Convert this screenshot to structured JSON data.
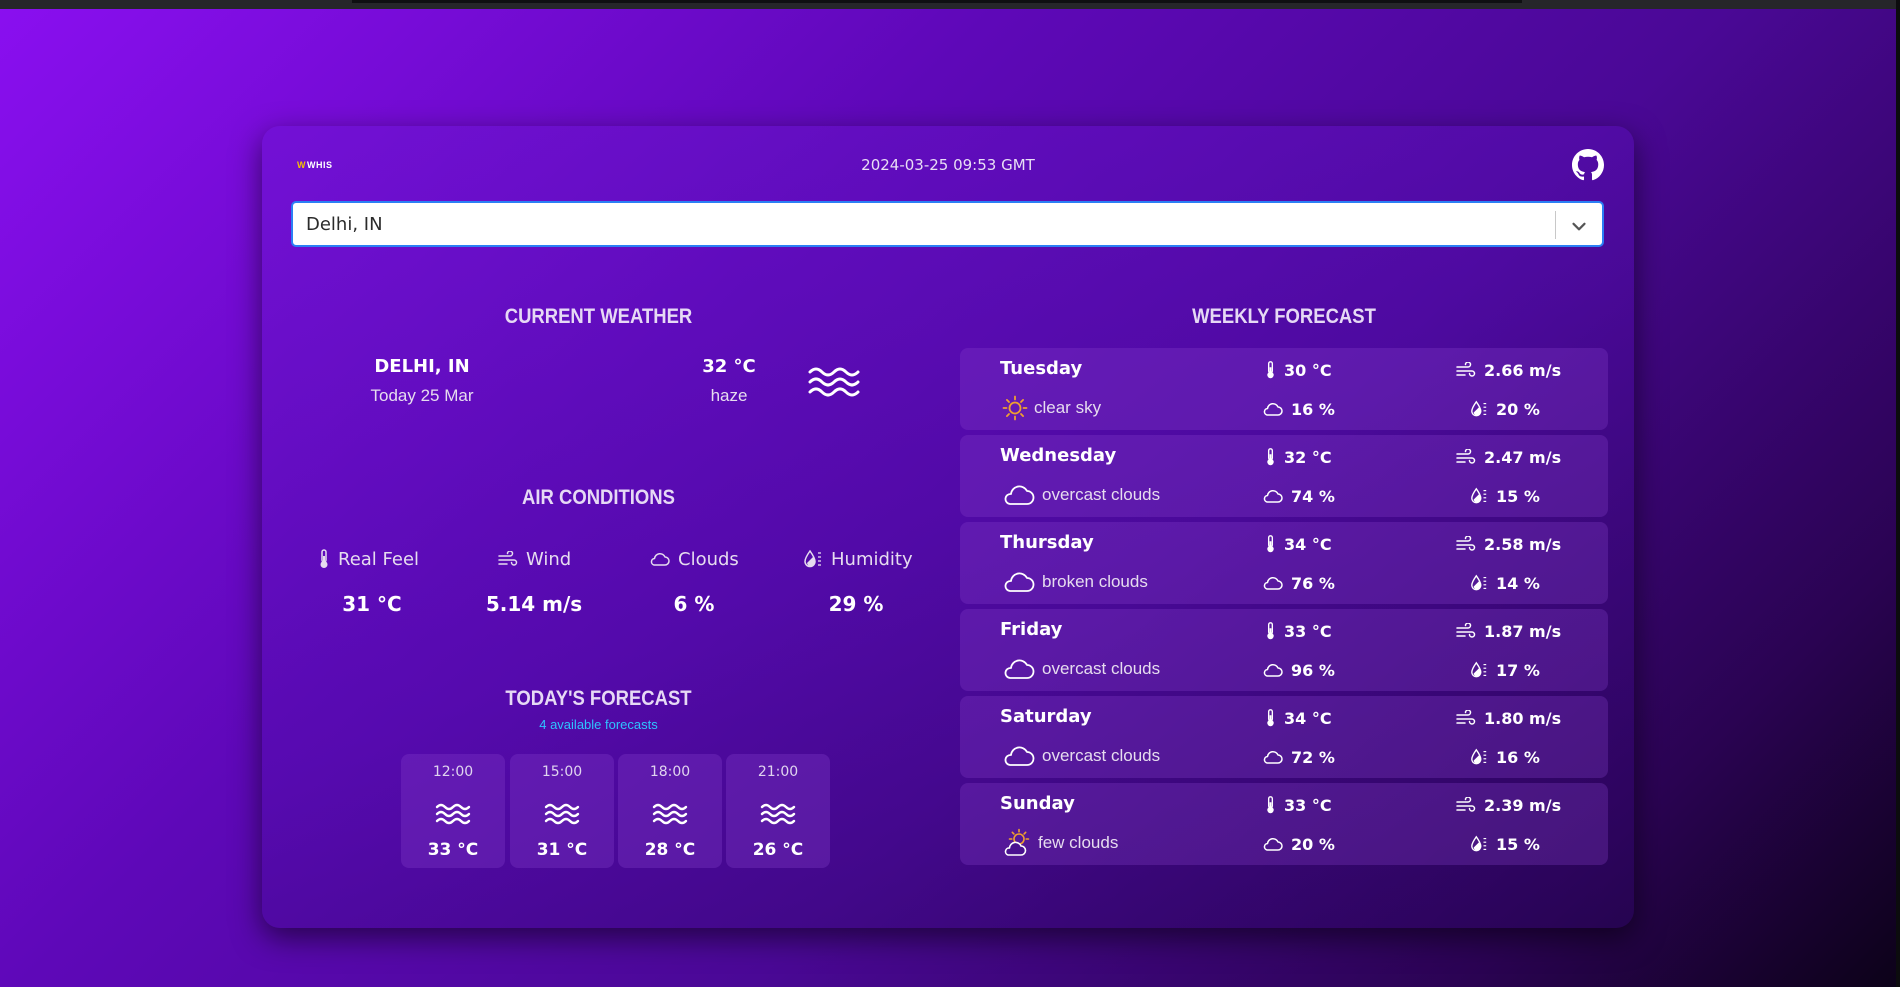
{
  "header": {
    "logo_mark": "W",
    "logo_text": "WHIS",
    "datetime": "2024-03-25 09:53 GMT",
    "github_icon": "github-icon"
  },
  "search": {
    "value": "Delhi, IN",
    "dropdown_icon": "chevron-down-icon"
  },
  "current_weather": {
    "title": "CURRENT WEATHER",
    "city": "DELHI, IN",
    "date": "Today 25 Mar",
    "temperature": "32 °C",
    "description": "haze",
    "icon": "haze-icon"
  },
  "air_conditions": {
    "title": "AIR CONDITIONS",
    "items": [
      {
        "label": "Real Feel",
        "value": "31 °C",
        "icon": "thermometer-icon"
      },
      {
        "label": "Wind",
        "value": "5.14 m/s",
        "icon": "wind-icon"
      },
      {
        "label": "Clouds",
        "value": "6 %",
        "icon": "cloud-icon"
      },
      {
        "label": "Humidity",
        "value": "29 %",
        "icon": "humidity-icon"
      }
    ]
  },
  "todays_forecast": {
    "title": "TODAY'S FORECAST",
    "subtitle": "4 available forecasts",
    "items": [
      {
        "time": "12:00",
        "temperature": "33 °C",
        "icon": "haze-icon"
      },
      {
        "time": "15:00",
        "temperature": "31 °C",
        "icon": "haze-icon"
      },
      {
        "time": "18:00",
        "temperature": "28 °C",
        "icon": "haze-icon"
      },
      {
        "time": "21:00",
        "temperature": "26 °C",
        "icon": "haze-icon"
      }
    ]
  },
  "weekly_forecast": {
    "title": "WEEKLY FORECAST",
    "days": [
      {
        "day": "Tuesday",
        "description": "clear sky",
        "icon": "sun-icon",
        "temperature": "30 °C",
        "wind": "2.66 m/s",
        "clouds": "16 %",
        "humidity": "20 %"
      },
      {
        "day": "Wednesday",
        "description": "overcast clouds",
        "icon": "cloud-icon",
        "temperature": "32 °C",
        "wind": "2.47 m/s",
        "clouds": "74 %",
        "humidity": "15 %"
      },
      {
        "day": "Thursday",
        "description": "broken clouds",
        "icon": "cloud-icon",
        "temperature": "34 °C",
        "wind": "2.58 m/s",
        "clouds": "76 %",
        "humidity": "14 %"
      },
      {
        "day": "Friday",
        "description": "overcast clouds",
        "icon": "cloud-icon",
        "temperature": "33 °C",
        "wind": "1.87 m/s",
        "clouds": "96 %",
        "humidity": "17 %"
      },
      {
        "day": "Saturday",
        "description": "overcast clouds",
        "icon": "cloud-icon",
        "temperature": "34 °C",
        "wind": "1.80 m/s",
        "clouds": "72 %",
        "humidity": "16 %"
      },
      {
        "day": "Sunday",
        "description": "few clouds",
        "icon": "sun-cloud-icon",
        "temperature": "33 °C",
        "wind": "2.39 m/s",
        "clouds": "20 %",
        "humidity": "15 %"
      }
    ]
  },
  "colors": {
    "accent_subtitle": "#2fc3ff",
    "logo_mark": "#f5c400",
    "search_border": "#2b7ff5",
    "sun": "#f0a030"
  }
}
